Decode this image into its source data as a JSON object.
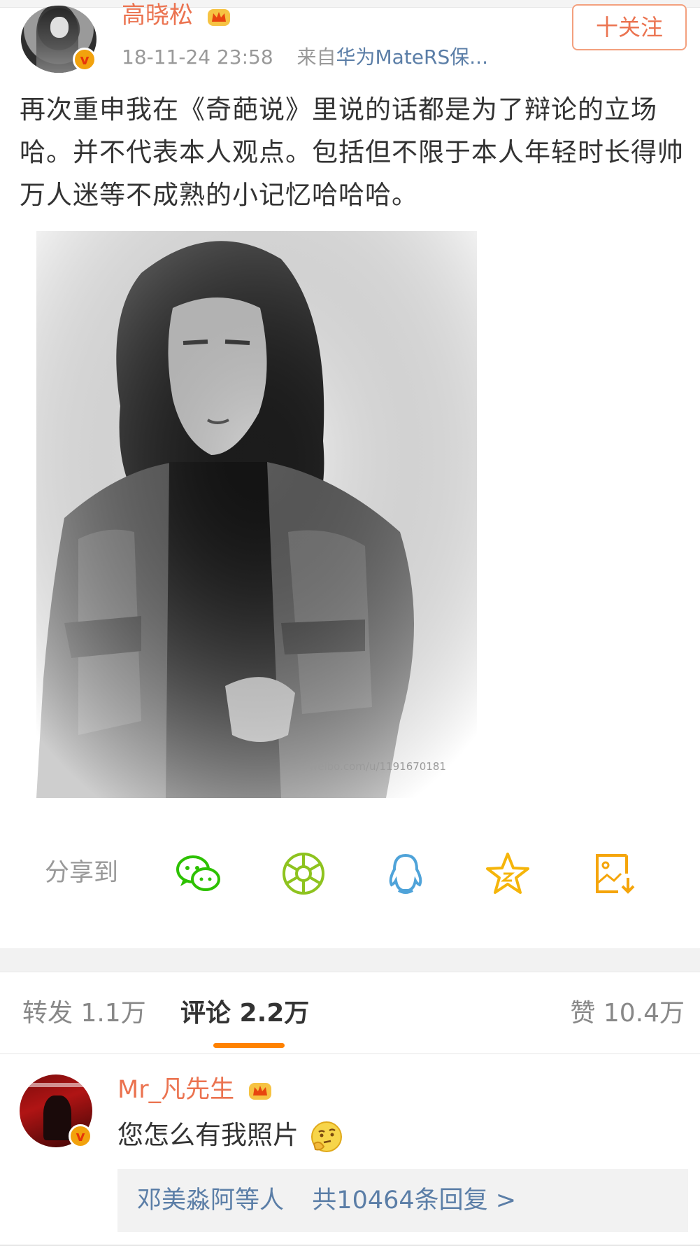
{
  "post": {
    "author": "高晓松",
    "time": "18-11-24 23:58",
    "source_prefix": "来自",
    "source": "华为MateRS保...",
    "follow_label": "十关注",
    "text": "再次重申我在《奇葩说》里说的话都是为了辩论的立场哈。并不代表本人观点。包括但不限于本人年轻时长得帅万人迷等不成熟的小记忆哈哈哈。",
    "photo_watermark": "weibo.com/u/1191670181"
  },
  "share": {
    "label": "分享到",
    "targets": [
      "wechat-icon",
      "moments-icon",
      "qq-icon",
      "qzone-star-icon",
      "save-image-icon"
    ]
  },
  "tabs": {
    "repost": "转发 1.1万",
    "comments": "评论 2.2万",
    "likes": "赞 10.4万"
  },
  "comment": {
    "user": "Mr_凡先生",
    "text": "您怎么有我照片",
    "reply_names": "邓美淼阿等人",
    "reply_count": "共10464条回复 >"
  },
  "colors": {
    "accent_orange": "#eb7350",
    "link_blue": "#5b7ea7",
    "tab_indicator": "#ff8200",
    "wechat_green": "#2dc100",
    "moments_green": "#8ec31f",
    "qq_blue": "#4fa3d9",
    "qzone_yellow": "#f5b50a"
  }
}
